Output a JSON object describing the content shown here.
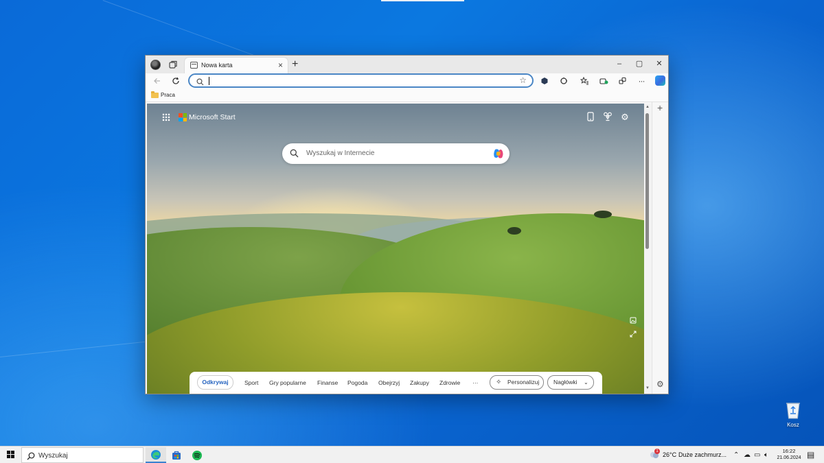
{
  "browser": {
    "tab_title": "Nowa karta",
    "new_tab_glyph": "+",
    "close_glyph": "×",
    "window_controls": {
      "minimize": "–",
      "maximize": "▢",
      "close": "✕"
    },
    "address_bar": {
      "value": ""
    },
    "favorites": [
      {
        "label": "Praca",
        "icon": "folder-icon"
      }
    ],
    "sidebar_add": "+",
    "icons": [
      "back-icon",
      "refresh-icon",
      "favorite-star-icon",
      "extension-icon",
      "browser-essentials-icon",
      "favorites-icon",
      "collections-icon",
      "workspaces-icon",
      "more-icon",
      "copilot-icon"
    ]
  },
  "newtab": {
    "brand": "Microsoft Start",
    "search_placeholder": "Wyszukaj w Internecie",
    "nav": {
      "active": "Odkrywaj",
      "items": [
        "Sport",
        "Gry popularne",
        "Finanse",
        "Pogoda",
        "Obejrzyj",
        "Zakupy",
        "Zdrowie",
        "···"
      ],
      "personalize": "Personalizuj",
      "headlines": "Nagłówki"
    }
  },
  "desktop": {
    "recycle_bin_label": "Kosz"
  },
  "taskbar": {
    "search_label": "Wyszukaj",
    "weather": {
      "temp": "26°C",
      "condition": "Duże zachmurz...",
      "badge": "1"
    },
    "time": "16:22",
    "date": "21.06.2024"
  },
  "colors": {
    "desktop_blue": "#0a6ad8",
    "accent": "#2563bf",
    "address_border": "#4a86c5"
  }
}
